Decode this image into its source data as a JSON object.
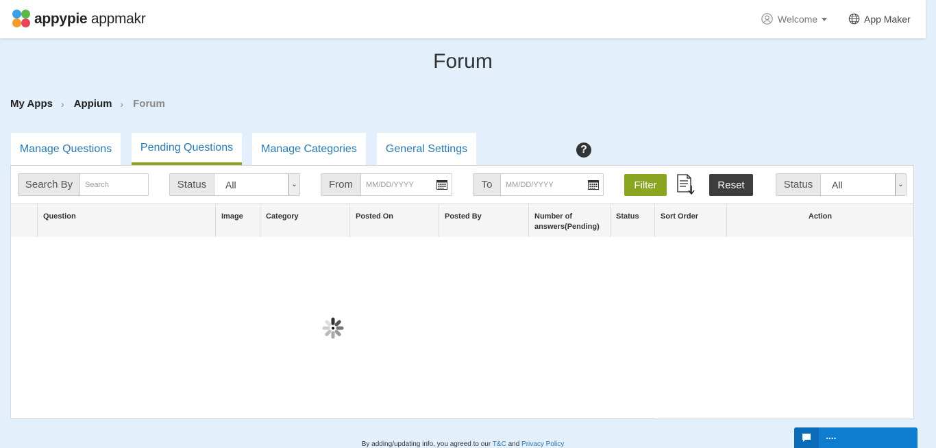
{
  "header": {
    "logo_brand": "appypie",
    "logo_product": "appmakr",
    "welcome_label": "Welcome",
    "app_maker_label": "App Maker"
  },
  "page": {
    "title": "Forum"
  },
  "breadcrumb": [
    {
      "label": "My Apps"
    },
    {
      "label": "Appium"
    },
    {
      "label": "Forum"
    }
  ],
  "tabs": [
    {
      "label": "Manage Questions",
      "active": false
    },
    {
      "label": "Pending Questions",
      "active": true
    },
    {
      "label": "Manage Categories",
      "active": false
    },
    {
      "label": "General Settings",
      "active": false
    }
  ],
  "filters": {
    "search_by_label": "Search By",
    "search_placeholder": "Search",
    "status_label": "Status",
    "status_value": "All",
    "from_label": "From",
    "from_placeholder": "MM/DD/YYYY",
    "to_label": "To",
    "to_placeholder": "MM/DD/YYYY",
    "filter_button": "Filter",
    "reset_button": "Reset",
    "status2_label": "Status",
    "status2_value": "All"
  },
  "table": {
    "columns": [
      "",
      "Question",
      "Image",
      "Category",
      "Posted On",
      "Posted By",
      "Number of answers(Pending)",
      "Status",
      "Sort Order",
      "Action"
    ]
  },
  "footer": {
    "text": "By adding/updating info, you agreed to our",
    "tc_link": "T&C",
    "and": "and",
    "privacy_link": "Privacy Policy"
  },
  "chat": {
    "label": "...."
  },
  "colors": {
    "accent_green": "#8aa520",
    "link_blue": "#2a7ab0",
    "page_bg": "#e3effb",
    "reset_dark": "#3d3d3d",
    "chat_blue": "#0e7dcf"
  }
}
